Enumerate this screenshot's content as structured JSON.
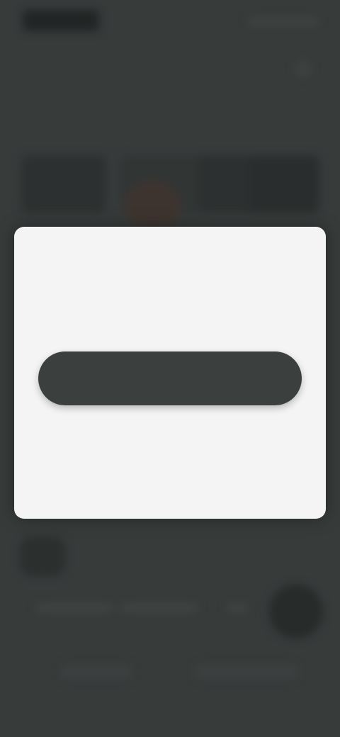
{
  "background": {
    "scrim_color": "#282c2b",
    "icons": [
      "overflow-menu-icon"
    ]
  },
  "dialog": {
    "title": "",
    "message": "",
    "primary_button_label": "",
    "secondary_link_label": "",
    "footer_text": ""
  },
  "colors": {
    "background": "#3f4443",
    "dialog_surface": "#f4f4f4",
    "primary_button": "#3b403f"
  }
}
